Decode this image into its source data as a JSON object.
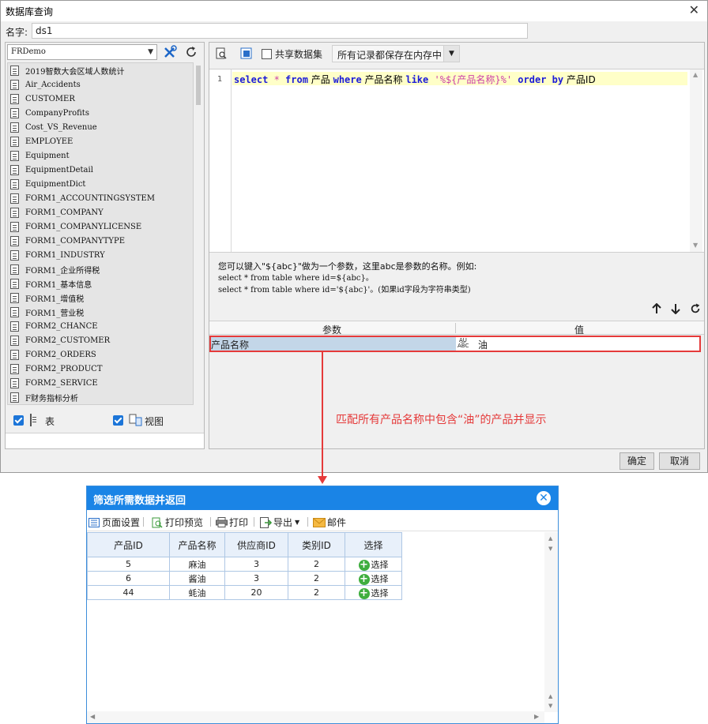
{
  "dialog": {
    "title": "数据库查询",
    "close_glyph": "✕",
    "name_label": "名字:",
    "name_value": "ds1",
    "ok_label": "确定",
    "cancel_label": "取消"
  },
  "left": {
    "db_name": "FRDemo",
    "tables": [
      "2019智数大会区域人数统计",
      "Air_Accidents",
      "CUSTOMER",
      "CompanyProfits",
      "Cost_VS_Revenue",
      "EMPLOYEE",
      "Equipment",
      "EquipmentDetail",
      "EquipmentDict",
      "FORM1_ACCOUNTINGSYSTEM",
      "FORM1_COMPANY",
      "FORM1_COMPANYLICENSE",
      "FORM1_COMPANYTYPE",
      "FORM1_INDUSTRY",
      "FORM1_企业所得税",
      "FORM1_基本信息",
      "FORM1_增值税",
      "FORM1_营业税",
      "FORM2_CHANCE",
      "FORM2_CUSTOMER",
      "FORM2_ORDERS",
      "FORM2_PRODUCT",
      "FORM2_SERVICE",
      "F财务指标分析"
    ],
    "table_check_label": "表",
    "view_check_label": "视图"
  },
  "right": {
    "share_label": "共享数据集",
    "memory_option": "所有记录都保存在内存中",
    "line_number": "1",
    "sql": {
      "t1": "select",
      "t2": " * ",
      "t3": "from",
      "t4": " 产品 ",
      "t5": "where",
      "t6": "  产品名称 ",
      "t7": "like",
      "t8": " '%${产品名称}%' ",
      "t9": "order by",
      "t10": " 产品ID"
    },
    "hint_line1": "您可以键入\"${abc}\"做为一个参数，这里abc是参数的名称。例如:",
    "hint_line2": "select * from table where id=${abc}。",
    "hint_line3": "select * from table where id='${abc}'。(如果id字段为字符串类型)",
    "param_header_name": "参数",
    "param_header_value": "值",
    "param_name": "产品名称",
    "param_value": "油",
    "abc_top": "A͟U",
    "abc_bottom": "ABC"
  },
  "annotation": "匹配所有产品名称中包含“油”的产品并显示",
  "result": {
    "title": "筛选所需数据并返回",
    "toolbar": [
      "页面设置",
      "打印预览",
      "打印",
      "导出",
      "邮件"
    ],
    "columns": [
      "产品ID",
      "产品名称",
      "供应商ID",
      "类别ID",
      "选择"
    ],
    "rows": [
      [
        "5",
        "麻油",
        "3",
        "2",
        "选择"
      ],
      [
        "6",
        "酱油",
        "3",
        "2",
        "选择"
      ],
      [
        "44",
        "蚝油",
        "20",
        "2",
        "选择"
      ]
    ]
  },
  "colors": {
    "accent": "#1a84e6",
    "annotation_red": "#e53a3a",
    "keyword_blue": "#1b1bd8",
    "string_pink": "#cc3fa8",
    "select_green": "#3fae3f"
  }
}
